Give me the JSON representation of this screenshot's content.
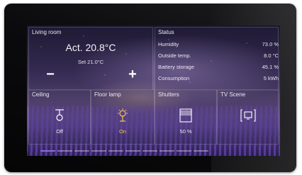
{
  "living_room": {
    "title": "Living room",
    "actual": "Act. 20.8°C",
    "setpoint": "Set 21.0°C",
    "minus": "−",
    "plus": "+"
  },
  "status": {
    "title": "Status",
    "rows": [
      {
        "label": "Humidity",
        "value": "73.0 %"
      },
      {
        "label": "Outside temp.",
        "value": "8.0 °C"
      },
      {
        "label": "Battery storage",
        "value": "45.1 %"
      },
      {
        "label": "Consumption",
        "value": "5 kWh"
      }
    ]
  },
  "tiles": [
    {
      "title": "Ceiling",
      "value": "Off",
      "icon": "ceiling-light-icon"
    },
    {
      "title": "Floor lamp",
      "value": "On",
      "icon": "floor-lamp-icon"
    },
    {
      "title": "Shutters",
      "value": "50 %",
      "icon": "shutters-icon"
    },
    {
      "title": "TV Scene",
      "value": "",
      "icon": "tv-scene-icon"
    }
  ],
  "colors": {
    "accent_on": "#f2c94c",
    "pager_active": "#8a6bd6"
  },
  "pager": {
    "pages": 10,
    "active": 1
  }
}
